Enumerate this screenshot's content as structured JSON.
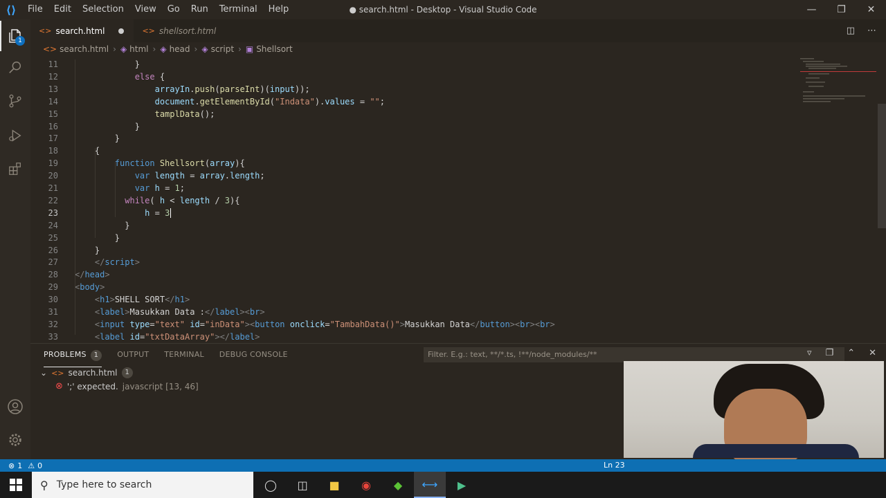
{
  "titlebar": {
    "menu": [
      "File",
      "Edit",
      "Selection",
      "View",
      "Go",
      "Run",
      "Terminal",
      "Help"
    ],
    "title": "● search.html - Desktop - Visual Studio Code"
  },
  "activitybar": {
    "explorer_badge": "1",
    "icons": [
      "files-icon",
      "search-icon",
      "source-control-icon",
      "run-debug-icon",
      "extensions-icon",
      "account-icon",
      "settings-gear-icon"
    ]
  },
  "tabs": [
    {
      "label": "search.html",
      "active": true,
      "dirty": true
    },
    {
      "label": "shellsort.html",
      "active": false
    }
  ],
  "breadcrumb": [
    "search.html",
    "html",
    "head",
    "script",
    "Shellsort"
  ],
  "editor": {
    "lines": [
      {
        "n": "11",
        "indent": "            ",
        "parts": [
          [
            "txt",
            "}"
          ]
        ]
      },
      {
        "n": "12",
        "indent": "            ",
        "parts": [
          [
            "kw2",
            "else"
          ],
          [
            "txt",
            " {"
          ]
        ]
      },
      {
        "n": "13",
        "indent": "                ",
        "parts": [
          [
            "var",
            "arrayIn"
          ],
          [
            "txt",
            "."
          ],
          [
            "fn",
            "push"
          ],
          [
            "txt",
            "("
          ],
          [
            "fn",
            "parseInt"
          ],
          [
            "txt",
            ")("
          ],
          [
            "var",
            "input"
          ],
          [
            "txt",
            "));"
          ]
        ]
      },
      {
        "n": "14",
        "indent": "                ",
        "parts": [
          [
            "var",
            "document"
          ],
          [
            "txt",
            "."
          ],
          [
            "fn",
            "getElementById"
          ],
          [
            "txt",
            "("
          ],
          [
            "str",
            "\"Indata\""
          ],
          [
            "txt",
            ")."
          ],
          [
            "var",
            "values"
          ],
          [
            "txt",
            " = "
          ],
          [
            "str",
            "\"\""
          ],
          [
            "txt",
            ";"
          ]
        ]
      },
      {
        "n": "15",
        "indent": "                ",
        "parts": [
          [
            "fn",
            "tamplData"
          ],
          [
            "txt",
            "();"
          ]
        ]
      },
      {
        "n": "16",
        "indent": "            ",
        "parts": [
          [
            "txt",
            "}"
          ]
        ]
      },
      {
        "n": "17",
        "indent": "        ",
        "parts": [
          [
            "txt",
            "}"
          ]
        ]
      },
      {
        "n": "18",
        "indent": "    ",
        "parts": [
          [
            "txt",
            "{"
          ]
        ]
      },
      {
        "n": "19",
        "indent": "        ",
        "parts": [
          [
            "kw",
            "function"
          ],
          [
            "txt",
            " "
          ],
          [
            "fn",
            "Shellsort"
          ],
          [
            "txt",
            "("
          ],
          [
            "var",
            "array"
          ],
          [
            "txt",
            "){"
          ]
        ]
      },
      {
        "n": "20",
        "indent": "            ",
        "parts": [
          [
            "kw",
            "var"
          ],
          [
            "txt",
            " "
          ],
          [
            "var",
            "length"
          ],
          [
            "txt",
            " = "
          ],
          [
            "var",
            "array"
          ],
          [
            "txt",
            "."
          ],
          [
            "var",
            "length"
          ],
          [
            "txt",
            ";"
          ]
        ]
      },
      {
        "n": "21",
        "indent": "            ",
        "parts": [
          [
            "kw",
            "var"
          ],
          [
            "txt",
            " "
          ],
          [
            "var",
            "h"
          ],
          [
            "txt",
            " = "
          ],
          [
            "num",
            "1"
          ],
          [
            "txt",
            ";"
          ]
        ]
      },
      {
        "n": "22",
        "indent": "          ",
        "parts": [
          [
            "kw2",
            "while"
          ],
          [
            "txt",
            "( "
          ],
          [
            "var",
            "h"
          ],
          [
            "txt",
            " < "
          ],
          [
            "var",
            "length"
          ],
          [
            "txt",
            " / "
          ],
          [
            "num",
            "3"
          ],
          [
            "txt",
            "){"
          ]
        ]
      },
      {
        "n": "23",
        "indent": "              ",
        "parts": [
          [
            "var",
            "h"
          ],
          [
            "txt",
            " = "
          ],
          [
            "num",
            "3"
          ]
        ]
      },
      {
        "n": "24",
        "indent": "          ",
        "parts": [
          [
            "txt",
            "}"
          ]
        ]
      },
      {
        "n": "25",
        "indent": "        ",
        "parts": [
          [
            "txt",
            "}"
          ]
        ]
      },
      {
        "n": "26",
        "indent": "    ",
        "parts": [
          [
            "txt",
            "}"
          ]
        ]
      },
      {
        "n": "27",
        "indent": "    ",
        "parts": [
          [
            "brk",
            "</"
          ],
          [
            "tag",
            "script"
          ],
          [
            "brk",
            ">"
          ]
        ]
      },
      {
        "n": "28",
        "indent": "",
        "parts": [
          [
            "brk",
            "</"
          ],
          [
            "tag",
            "head"
          ],
          [
            "brk",
            ">"
          ]
        ]
      },
      {
        "n": "29",
        "indent": "",
        "parts": [
          [
            "brk",
            "<"
          ],
          [
            "tag",
            "body"
          ],
          [
            "brk",
            ">"
          ]
        ]
      },
      {
        "n": "30",
        "indent": "    ",
        "parts": [
          [
            "brk",
            "<"
          ],
          [
            "tag",
            "h1"
          ],
          [
            "brk",
            ">"
          ],
          [
            "txt",
            "SHELL SORT"
          ],
          [
            "brk",
            "</"
          ],
          [
            "tag",
            "h1"
          ],
          [
            "brk",
            ">"
          ]
        ]
      },
      {
        "n": "31",
        "indent": "    ",
        "parts": [
          [
            "brk",
            "<"
          ],
          [
            "tag",
            "label"
          ],
          [
            "brk",
            ">"
          ],
          [
            "txt",
            "Masukkan Data :"
          ],
          [
            "brk",
            "</"
          ],
          [
            "tag",
            "label"
          ],
          [
            "brk",
            "><"
          ],
          [
            "tag",
            "br"
          ],
          [
            "brk",
            ">"
          ]
        ]
      },
      {
        "n": "32",
        "indent": "    ",
        "parts": [
          [
            "brk",
            "<"
          ],
          [
            "tag",
            "input"
          ],
          [
            "txt",
            " "
          ],
          [
            "attr",
            "type"
          ],
          [
            "txt",
            "="
          ],
          [
            "str",
            "\"text\""
          ],
          [
            "txt",
            " "
          ],
          [
            "attr",
            "id"
          ],
          [
            "txt",
            "="
          ],
          [
            "str",
            "\"inData\""
          ],
          [
            "brk",
            "><"
          ],
          [
            "tag",
            "button"
          ],
          [
            "txt",
            " "
          ],
          [
            "attr",
            "onclick"
          ],
          [
            "txt",
            "="
          ],
          [
            "str",
            "\"TambahData()\""
          ],
          [
            "brk",
            ">"
          ],
          [
            "txt",
            "Masukkan Data"
          ],
          [
            "brk",
            "</"
          ],
          [
            "tag",
            "button"
          ],
          [
            "brk",
            "><"
          ],
          [
            "tag",
            "br"
          ],
          [
            "brk",
            "><"
          ],
          [
            "tag",
            "br"
          ],
          [
            "brk",
            ">"
          ]
        ]
      },
      {
        "n": "33",
        "indent": "    ",
        "parts": [
          [
            "brk",
            "<"
          ],
          [
            "tag",
            "label"
          ],
          [
            "txt",
            " "
          ],
          [
            "attr",
            "id"
          ],
          [
            "txt",
            "="
          ],
          [
            "str",
            "\"txtDataArray\""
          ],
          [
            "brk",
            "></"
          ],
          [
            "tag",
            "label"
          ],
          [
            "brk",
            ">"
          ]
        ]
      }
    ]
  },
  "panel": {
    "tabs": [
      {
        "label": "PROBLEMS",
        "count": "1",
        "active": true
      },
      {
        "label": "OUTPUT"
      },
      {
        "label": "TERMINAL"
      },
      {
        "label": "DEBUG CONSOLE"
      }
    ],
    "filter_placeholder": "Filter. E.g.: text, **/*.ts, !**/node_modules/**",
    "problem_file": "search.html",
    "problem_file_count": "1",
    "problem_message": "';' expected.",
    "problem_source": "javascript  [13, 46]"
  },
  "statusbar": {
    "errors": "1",
    "warnings": "0",
    "position": "Ln 23"
  },
  "taskbar": {
    "search_placeholder": "Type here to search"
  }
}
